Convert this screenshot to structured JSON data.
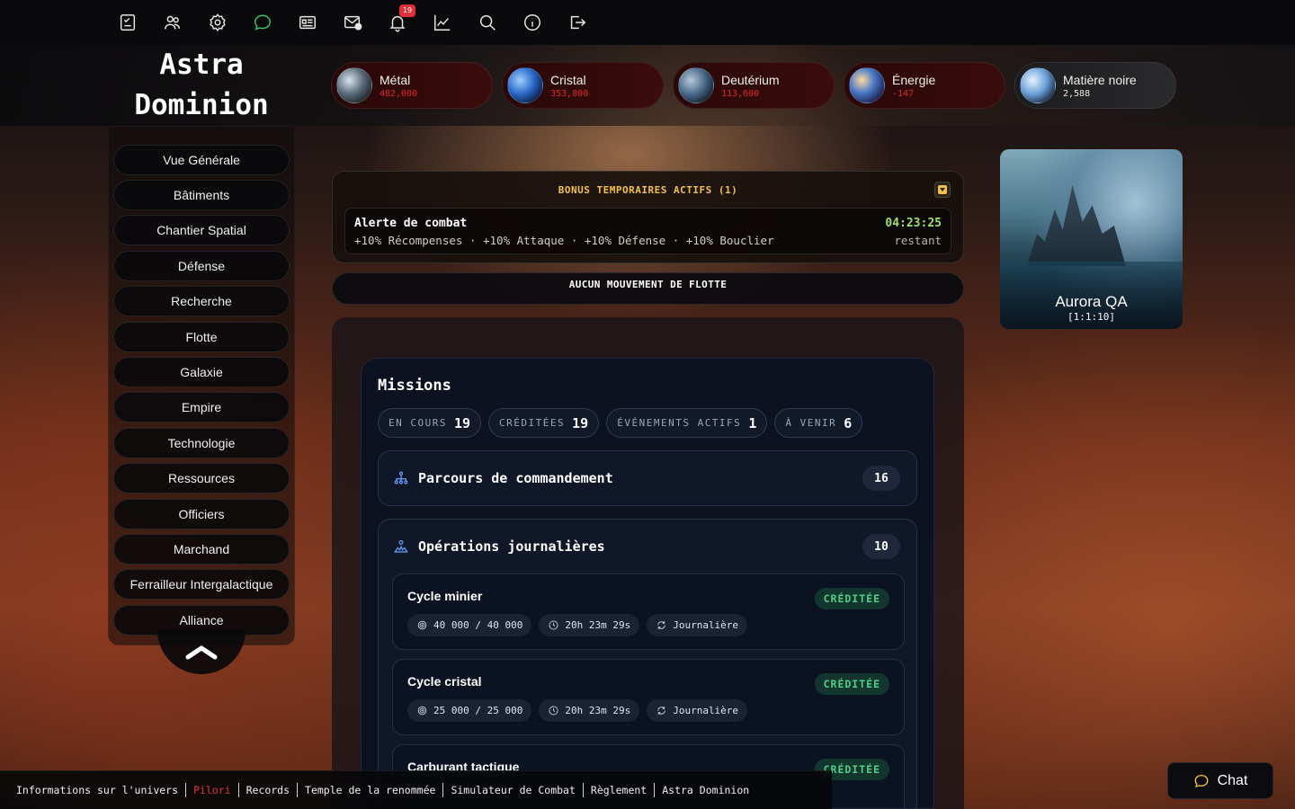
{
  "topbar": {
    "icons": [
      "tasks-icon",
      "users-icon",
      "settings-icon",
      "messages-icon",
      "news-icon",
      "mail-icon",
      "notifications-icon",
      "stats-icon",
      "search-icon",
      "info-icon",
      "logout-icon"
    ],
    "notification_count": "19"
  },
  "brand": {
    "line1": "Astra",
    "line2": "Dominion"
  },
  "resources": [
    {
      "name": "Métal",
      "value": "482,000",
      "value_color": "red"
    },
    {
      "name": "Cristal",
      "value": "353,800",
      "value_color": "red"
    },
    {
      "name": "Deutérium",
      "value": "113,600",
      "value_color": "red"
    },
    {
      "name": "Énergie",
      "value": "-147",
      "value_color": "red"
    },
    {
      "name": "Matière noire",
      "value": "2,588",
      "value_color": "white"
    }
  ],
  "sidebar": {
    "items": [
      "Vue Générale",
      "Bâtiments",
      "Chantier Spatial",
      "Défense",
      "Recherche",
      "Flotte",
      "Galaxie",
      "Empire",
      "Technologie",
      "Ressources",
      "Officiers",
      "Marchand",
      "Ferrailleur Intergalactique",
      "Alliance"
    ]
  },
  "bonus": {
    "title": "BONUS TEMPORAIRES ACTIFS (1)",
    "item": {
      "name": "Alerte de combat",
      "effects": "+10% Récompenses · +10% Attaque · +10% Défense · +10% Bouclier",
      "time": "04:23:25",
      "remaining_label": "restant"
    }
  },
  "fleet": {
    "status": "AUCUN MOUVEMENT DE FLOTTE"
  },
  "planet": {
    "name": "Aurora QA",
    "coords": "[1:1:10]"
  },
  "missions": {
    "title": "Missions",
    "stats": [
      {
        "label": "EN COURS",
        "value": "19"
      },
      {
        "label": "CRÉDITÉES",
        "value": "19"
      },
      {
        "label": "ÉVÉNEMENTS ACTIFS",
        "value": "1"
      },
      {
        "label": "À VENIR",
        "value": "6"
      }
    ],
    "sections": [
      {
        "title": "Parcours de commandement",
        "count": "16"
      },
      {
        "title": "Opérations journalières",
        "count": "10"
      }
    ],
    "items": [
      {
        "name": "Cycle minier",
        "status": "CRÉDITÉE",
        "progress": "40 000 / 40 000",
        "timer": "20h 23m 29s",
        "frequency": "Journalière"
      },
      {
        "name": "Cycle cristal",
        "status": "CRÉDITÉE",
        "progress": "25 000 / 25 000",
        "timer": "20h 23m 29s",
        "frequency": "Journalière"
      },
      {
        "name": "Carburant tactique",
        "status": "CRÉDITÉE"
      }
    ]
  },
  "footer": {
    "links": [
      "Informations sur l'univers",
      "Pilori",
      "Records",
      "Temple de la renommée",
      "Simulateur de Combat",
      "Règlement",
      "Astra Dominion"
    ]
  },
  "chat": {
    "label": "Chat"
  },
  "colors": {
    "accent_gold": "#f2c04a",
    "danger_red": "#e0313a",
    "success_green": "#4ed08a",
    "timer_green": "#9ee06a",
    "active_icon_green": "#36c46a"
  }
}
